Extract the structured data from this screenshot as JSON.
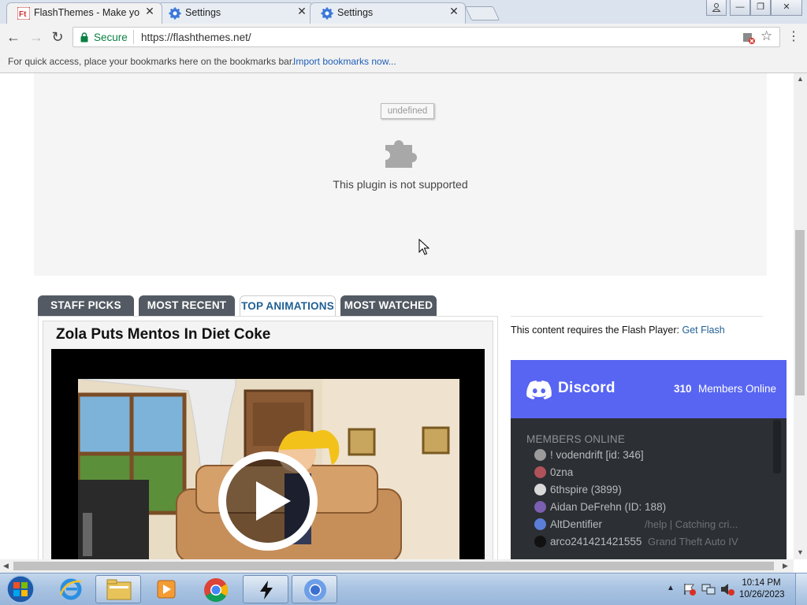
{
  "browser": {
    "tabs": [
      {
        "title": "FlashThemes - Make your",
        "active": true
      },
      {
        "title": "Settings",
        "active": false
      },
      {
        "title": "Settings",
        "active": false
      }
    ],
    "address": {
      "secure_label": "Secure",
      "url": "https://flashthemes.net/"
    },
    "bookmarks_bar": {
      "hint": "For quick access, place your bookmarks here on the bookmarks bar.",
      "import_link": "Import bookmarks now..."
    }
  },
  "page": {
    "plugin": {
      "badge": "undefined",
      "message": "This plugin is not supported"
    },
    "feature_tabs": [
      "STAFF PICKS",
      "MOST RECENT",
      "TOP ANIMATIONS",
      "MOST WATCHED"
    ],
    "active_tab": "TOP ANIMATIONS",
    "video": {
      "title": "Zola Puts Mentos In Diet Coke"
    },
    "flash_notice": {
      "text": "This content requires the Flash Player: ",
      "link": "Get Flash"
    },
    "discord": {
      "brand": "Discord",
      "online_count": "310",
      "online_label": "Members Online",
      "section_title": "MEMBERS ONLINE",
      "members": [
        {
          "name": "! vodendrift [id: 346]",
          "game": "",
          "color": "#9b9b9b"
        },
        {
          "name": "0zna",
          "game": "",
          "color": "#b0525a"
        },
        {
          "name": "6thspire (3899)",
          "game": "",
          "color": "#d9d9d9"
        },
        {
          "name": "Aidan DeFrehn (ID: 188)",
          "game": "",
          "color": "#7b5fb0"
        },
        {
          "name": "AltDentifier",
          "game": "/help | Catching cri...",
          "color": "#5b7fd6"
        },
        {
          "name": "arco241421421555",
          "game": "Grand Theft Auto IV",
          "color": "#111111"
        }
      ]
    }
  },
  "taskbar": {
    "clock_time": "10:14 PM",
    "clock_date": "10/26/2023"
  },
  "colors": {
    "discord_blurple": "#5865f2",
    "discord_dark": "#2c2f33",
    "tab_dark": "#535a63",
    "link_blue": "#1f5f94"
  }
}
